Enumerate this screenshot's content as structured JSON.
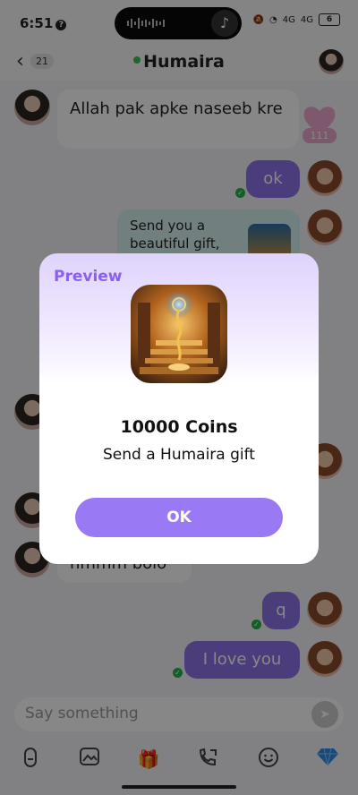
{
  "status": {
    "time": "6:51",
    "net1": "4G",
    "net2": "4G",
    "battery": "6"
  },
  "header": {
    "back_count": "21",
    "title": "Humaira"
  },
  "messages": {
    "m1": "Allah pak apke naseeb kre",
    "like_count": "111",
    "m2": "ok",
    "m3": "Send you a beautiful gift,",
    "m4": "hmmm bolo",
    "m5": "q",
    "m6": "I love you"
  },
  "input": {
    "placeholder": "Say something"
  },
  "toolbar": {
    "icons": [
      "microphone-icon",
      "image-icon",
      "gift-icon",
      "video-call-icon",
      "emoji-icon",
      "diamond-icon"
    ]
  },
  "modal": {
    "title": "Preview",
    "coins": "10000 Coins",
    "subtitle": "Send a Humaira gift",
    "ok_label": "OK"
  },
  "colors": {
    "accent": "#8f74ea",
    "ok_button": "#9a7af4",
    "online": "#3dbd5a"
  }
}
